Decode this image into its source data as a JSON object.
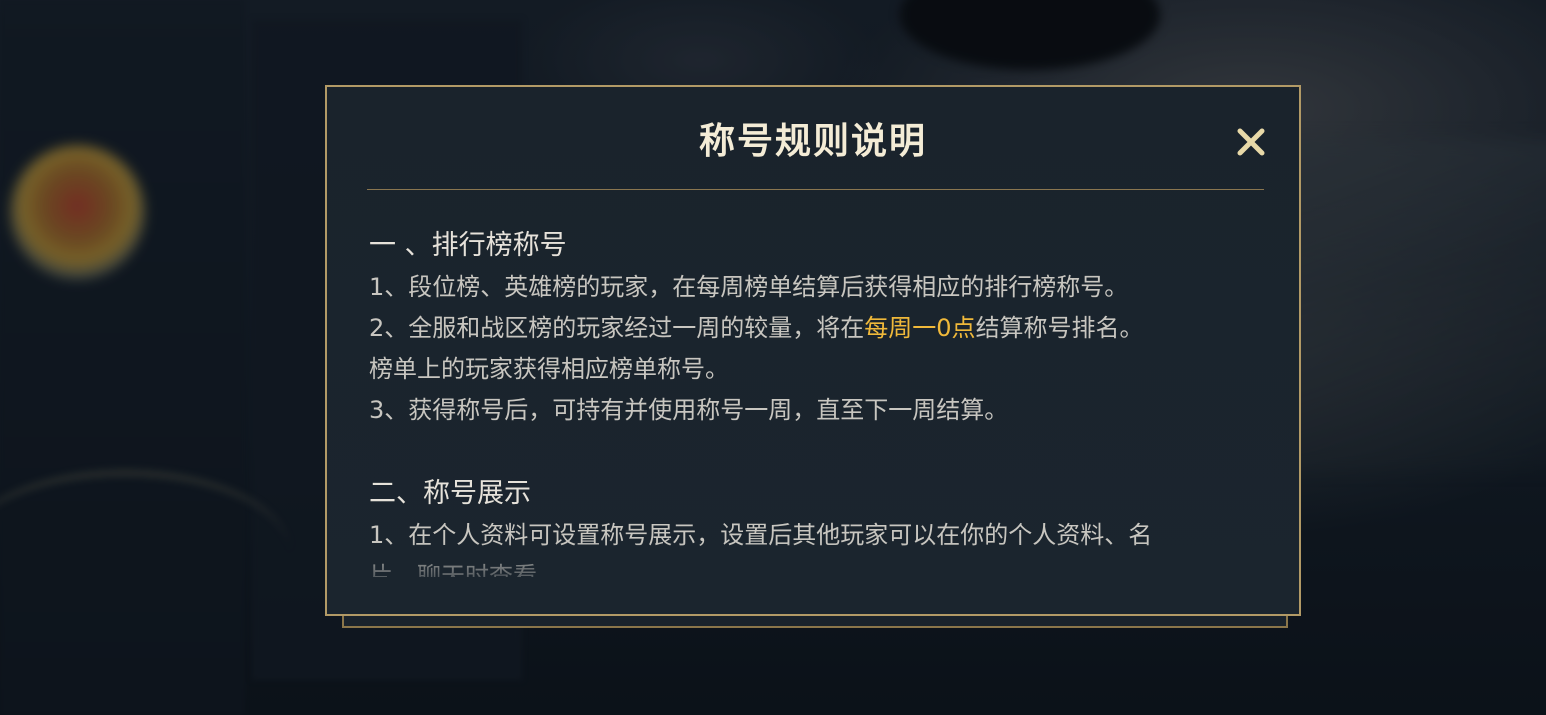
{
  "dialog": {
    "title": "称号规则说明",
    "close_icon": "close-icon",
    "colors": {
      "frame": "#b29a66",
      "background": "#1a232c",
      "title": "#f4ecd6",
      "highlight": "#f0b93a",
      "body_text": "#c8c6c0"
    }
  },
  "sections": [
    {
      "heading": "一 、排行榜称号",
      "lines": [
        {
          "text": "1、段位榜、英雄榜的玩家，在每周榜单结算后获得相应的排行榜称号。"
        },
        {
          "before": "2、全服和战区榜的玩家经过一周的较量，将在",
          "highlight": "每周一0点",
          "after": "结算称号排名。"
        },
        {
          "text": "榜单上的玩家获得相应榜单称号。"
        },
        {
          "text": "3、获得称号后，可持有并使用称号一周，直至下一周结算。"
        }
      ]
    },
    {
      "heading": "二、称号展示",
      "lines": [
        {
          "text": "1、在个人资料可设置称号展示，设置后其他玩家可以在你的个人资料、名"
        },
        {
          "text": "片、聊天时查看"
        }
      ]
    }
  ]
}
